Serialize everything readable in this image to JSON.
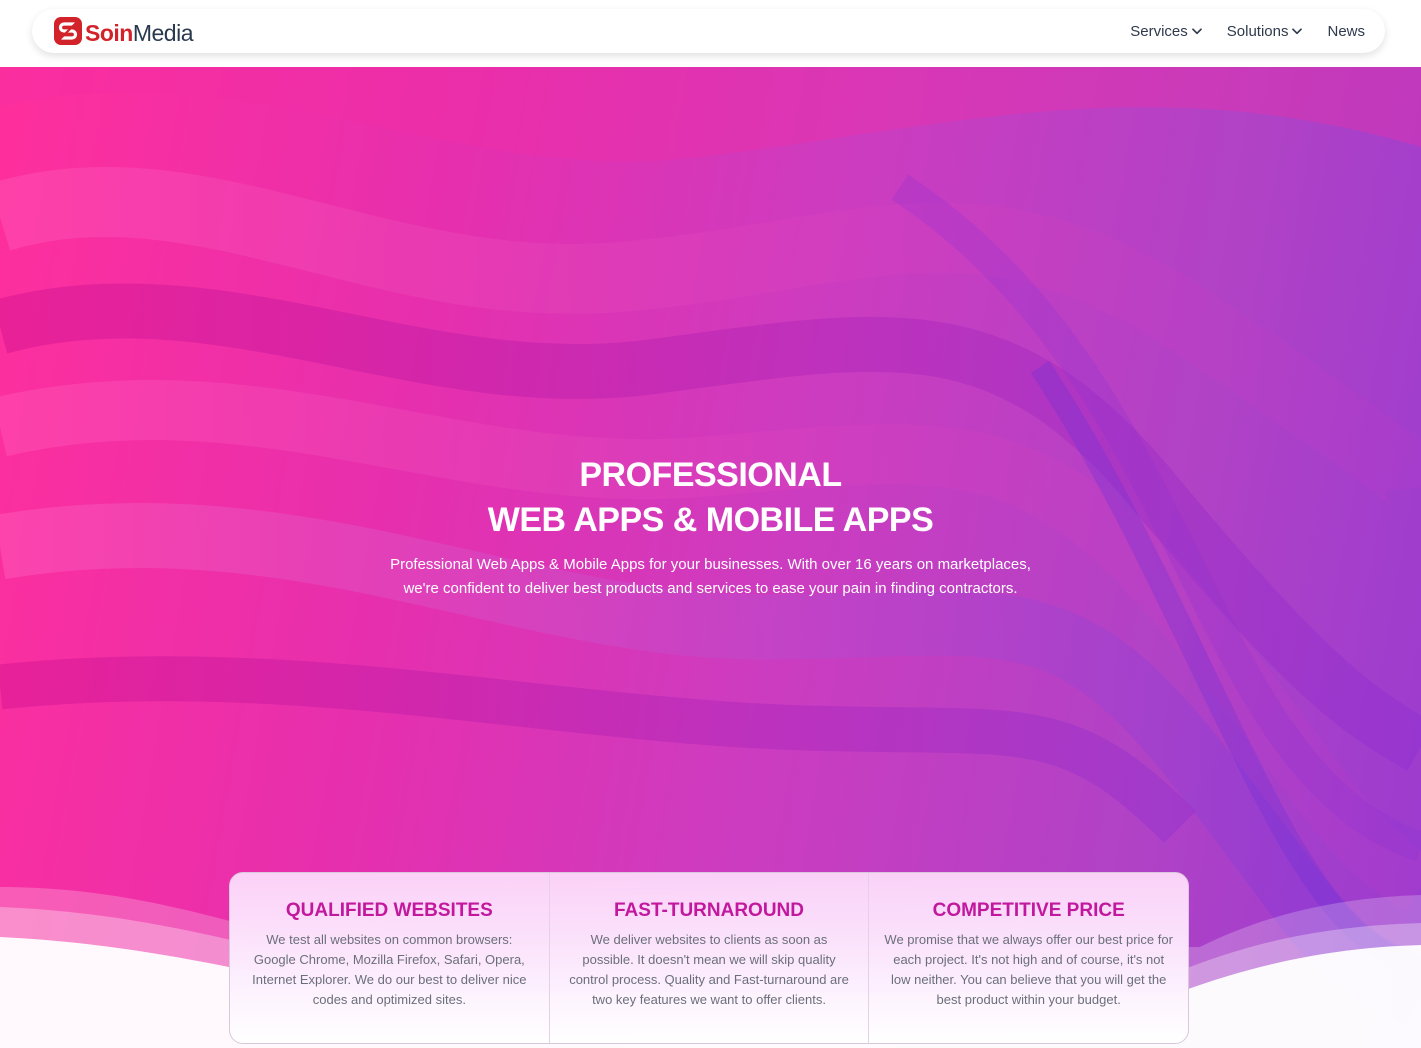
{
  "brand": {
    "name_part1": "Soin",
    "name_part2": "Media",
    "colors": {
      "red": "#d2232a",
      "dark": "#2a3a4e"
    }
  },
  "nav": {
    "items": [
      {
        "label": "Services",
        "icon": "chevron-down-icon"
      },
      {
        "label": "Solutions",
        "icon": "chevron-down-icon"
      },
      {
        "label": "News"
      }
    ]
  },
  "hero": {
    "title_line1": "PROFESSIONAL",
    "title_line2": "WEB APPS & MOBILE APPS",
    "subtitle_line1": "Professional Web Apps & Mobile Apps for your businesses. With over 16 years on marketplaces,",
    "subtitle_line2": "we're confident to deliver best products and services to ease your pain in finding contractors.",
    "gradient_colors": [
      "#ff2f9c",
      "#cc3cc0",
      "#9a3bd0"
    ]
  },
  "features": [
    {
      "title": "QUALIFIED WEBSITES",
      "text": "We test all websites on common browsers: Google Chrome, Mozilla Firefox, Safari, Opera, Internet Explorer. We do our best to deliver nice codes and optimized sites."
    },
    {
      "title": "FAST-TURNAROUND",
      "text": "We deliver websites to clients as soon as possible. It doesn't mean we will skip quality control process. Quality and Fast-turnaround are two key features we want to offer clients."
    },
    {
      "title": "COMPETITIVE PRICE",
      "text": "We promise that we always offer our best price for each project. It's not high and of course, it's not low neither. You can believe that you will get the best product within your budget."
    }
  ],
  "accent_color": "#c2189e"
}
